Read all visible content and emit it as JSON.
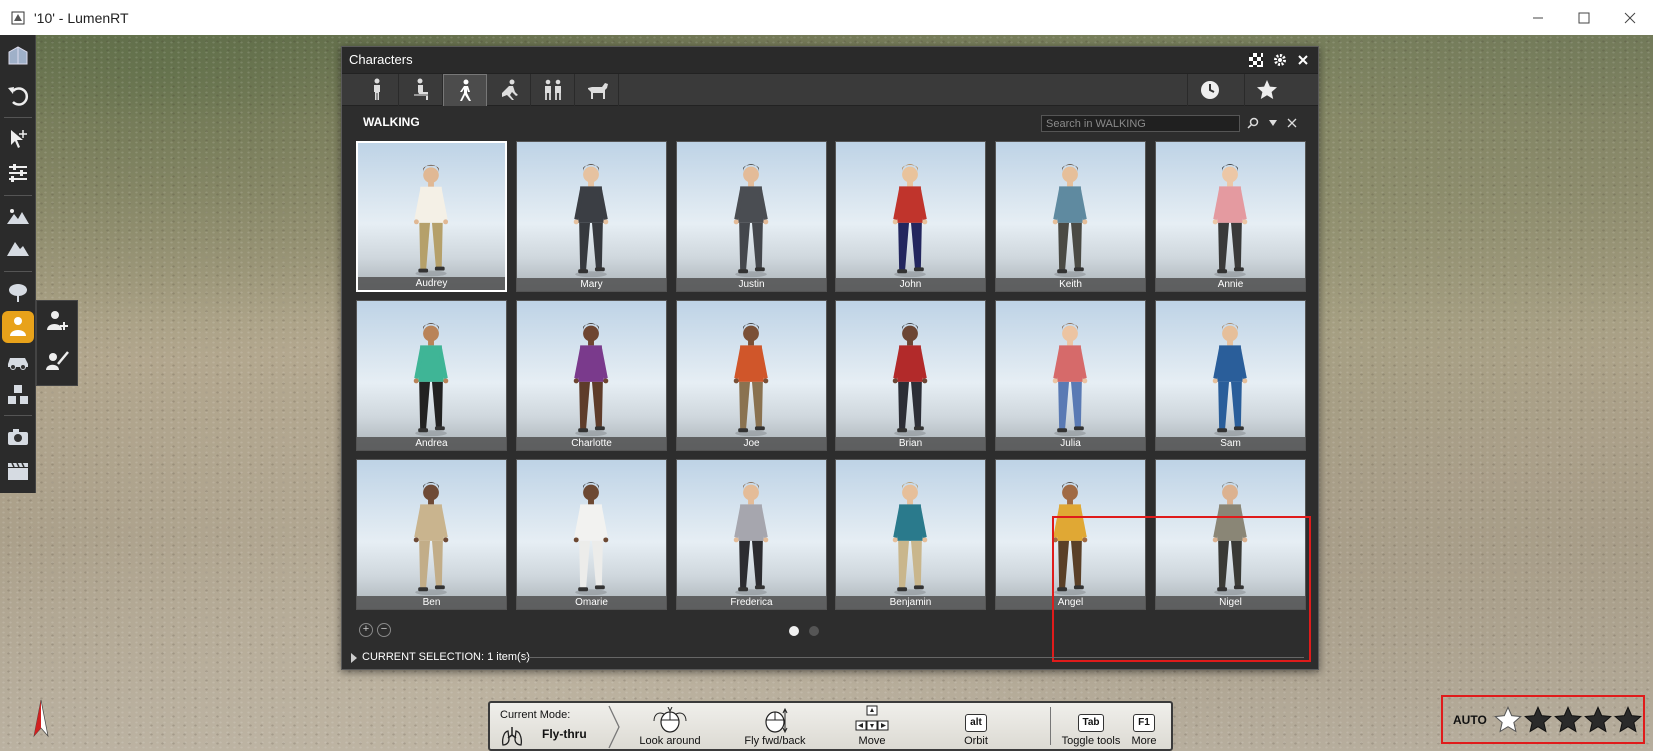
{
  "window": {
    "title": "'10' - LumenRT",
    "controls": [
      "minimize",
      "maximize",
      "close"
    ]
  },
  "left_toolbar": {
    "items": [
      {
        "name": "scene-icon"
      },
      {
        "name": "undo-icon"
      },
      {
        "name": "select-move-icon"
      },
      {
        "name": "adjust-sliders-icon"
      },
      {
        "name": "landscape-icon"
      },
      {
        "name": "terrain-icon"
      },
      {
        "name": "tree-icon"
      },
      {
        "name": "character-icon",
        "active": true
      },
      {
        "name": "car-icon"
      },
      {
        "name": "objects-icon"
      },
      {
        "name": "camera-icon"
      },
      {
        "name": "movie-icon"
      }
    ],
    "sub_tools": [
      {
        "name": "add-character-icon"
      },
      {
        "name": "paint-character-icon"
      }
    ]
  },
  "panel": {
    "title": "Characters",
    "header_buttons": [
      "checker-icon",
      "gear-icon",
      "close-icon"
    ],
    "category_tabs": [
      {
        "name": "standing-icon",
        "active": false
      },
      {
        "name": "sitting-icon",
        "active": false
      },
      {
        "name": "walking-icon",
        "active": true
      },
      {
        "name": "activity-icon",
        "active": false
      },
      {
        "name": "groups-icon",
        "active": false
      },
      {
        "name": "animals-icon",
        "active": false
      }
    ],
    "right_tabs": [
      "recent-icon",
      "favorites-icon"
    ],
    "section_title": "WALKING",
    "search_placeholder": "Search in WALKING",
    "characters": [
      {
        "name": "Audrey",
        "selected": true,
        "top": "#f4f0e6",
        "bottom": "#b5a06a",
        "skin": "#e0b894",
        "hair": "#5a3a22"
      },
      {
        "name": "Mary",
        "top": "#3b3e44",
        "bottom": "#36393e",
        "skin": "#e6c2a0",
        "hair": "#3a2a1e"
      },
      {
        "name": "Justin",
        "top": "#4a4d52",
        "bottom": "#44474c",
        "skin": "#e3bb98",
        "hair": "#2e2a26"
      },
      {
        "name": "John",
        "top": "#c0342c",
        "bottom": "#23265e",
        "skin": "#e9c39c",
        "hair": "#b07a3e"
      },
      {
        "name": "Keith",
        "top": "#5f8aa0",
        "bottom": "#4a4a44",
        "skin": "#e6bf9a",
        "hair": "#4a3624"
      },
      {
        "name": "Annie",
        "top": "#e49aa0",
        "bottom": "#3a3a3a",
        "skin": "#ecc7a6",
        "hair": "#151515"
      },
      {
        "name": "Andrea",
        "top": "#3fb596",
        "bottom": "#222222",
        "skin": "#b98358",
        "hair": "#3e2616"
      },
      {
        "name": "Charlotte",
        "top": "#7a3a8c",
        "bottom": "#5e3c2a",
        "skin": "#6e4530",
        "hair": "#1e120a"
      },
      {
        "name": "Joe",
        "top": "#d0562a",
        "bottom": "#8a7250",
        "skin": "#7a5036",
        "hair": "#1a1410"
      },
      {
        "name": "Brian",
        "top": "#b22a2a",
        "bottom": "#2c2e36",
        "skin": "#6c4634",
        "hair": "#141010"
      },
      {
        "name": "Julia",
        "top": "#d66a6a",
        "bottom": "#5a7ab4",
        "skin": "#ecc4a2",
        "hair": "#7a4c2a"
      },
      {
        "name": "Sam",
        "top": "#2a5e9a",
        "bottom": "#2a5e9a",
        "skin": "#e6bf9a",
        "hair": "#a07044"
      },
      {
        "name": "Ben",
        "top": "#c9b48e",
        "bottom": "#c2ad88",
        "skin": "#6e4a36",
        "hair": "#1a1410"
      },
      {
        "name": "Omarie",
        "top": "#f2f2f0",
        "bottom": "#ececea",
        "skin": "#6c4832",
        "hair": "#141010"
      },
      {
        "name": "Frederica",
        "top": "#a6a6ae",
        "bottom": "#2c2c30",
        "skin": "#e4bc98",
        "hair": "#7a5230"
      },
      {
        "name": "Benjamin",
        "top": "#2a7a8c",
        "bottom": "#c9b68c",
        "skin": "#e6bf9a",
        "hair": "#b48a4a"
      },
      {
        "name": "Angel",
        "top": "#e0a834",
        "bottom": "#5a4028",
        "skin": "#a06a44",
        "hair": "#2a1a10"
      },
      {
        "name": "Nigel",
        "top": "#8a8676",
        "bottom": "#3a3a36",
        "skin": "#dcb290",
        "hair": "#6a6a62"
      }
    ],
    "pages": {
      "count": 2,
      "current": 1
    },
    "current_selection": "CURRENT SELECTION: 1 item(s)"
  },
  "mode_bar": {
    "current_mode_label": "Current Mode:",
    "current_mode_value": "Fly-thru",
    "items": [
      {
        "label": "Look around"
      },
      {
        "label": "Fly fwd/back"
      },
      {
        "label": "Move"
      },
      {
        "label": "Orbit",
        "key": "alt"
      },
      {
        "label": "Toggle tools",
        "key": "Tab"
      },
      {
        "label": "More",
        "key": "F1"
      }
    ]
  },
  "quality": {
    "auto_label": "AUTO",
    "level": 1,
    "max": 5
  }
}
